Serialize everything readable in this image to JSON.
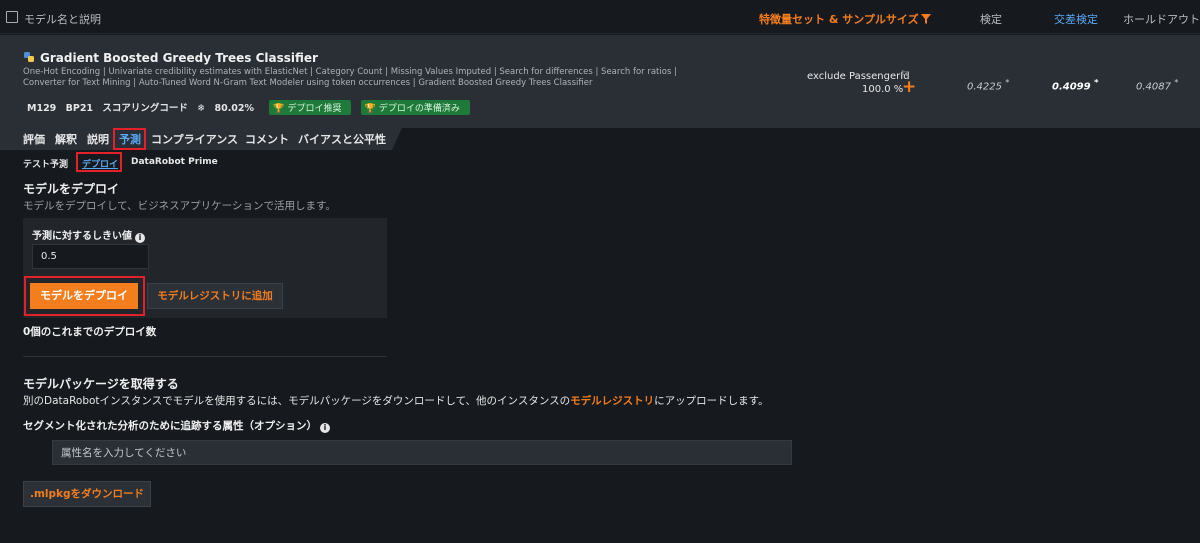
{
  "header": {
    "model_name_label": "モデル名と説明",
    "feature_set_label": "特徴量セット & サンプルサイズ",
    "validation_label": "検定",
    "cross_validation_label": "交差検定",
    "holdout_label": "ホールドアウト"
  },
  "model": {
    "title": "Gradient Boosted Greedy Trees Classifier",
    "description": "One-Hot Encoding | Univariate credibility estimates with ElasticNet | Category Count | Missing Values Imputed | Search for differences | Search for ratios | Converter for Text Mining | Auto-Tuned Word N-Gram Text Modeler using token occurrences | Gradient Boosted Greedy Trees Classifier",
    "model_id": "M129",
    "blueprint_id": "BP21",
    "scoring_code": "スコアリングコード",
    "accuracy": "80.02%",
    "badge_recommended": "デプロイ推奨",
    "badge_ready": "デプロイの準備済み",
    "feature_list": "exclude PassengerId",
    "sample_size": "100.0 %",
    "score_validation": "0.4225",
    "score_cv": "0.4099",
    "score_holdout": "0.4087",
    "score_marker": "*"
  },
  "tabs": [
    "評価",
    "解釈",
    "説明",
    "予測",
    "コンプライアンス",
    "コメント",
    "バイアスと公平性"
  ],
  "subtabs": [
    "テスト予測",
    "デプロイ",
    "DataRobot Prime"
  ],
  "deploy": {
    "title": "モデルをデプロイ",
    "subtitle": "モデルをデプロイして、ビジネスアプリケーションで活用します。",
    "threshold_label": "予測に対するしきい値",
    "threshold_value": "0.5",
    "deploy_button": "モデルをデプロイ",
    "registry_button": "モデルレジストリに追加",
    "deploy_count": "0個のこれまでのデプロイ数"
  },
  "package": {
    "title": "モデルパッケージを取得する",
    "text_before": "別のDataRobotインスタンスでモデルを使用するには、モデルパッケージをダウンロードして、他のインスタンスの",
    "text_link": "モデルレジストリ",
    "text_after": "にアップロードします。",
    "attribute_label": "セグメント化された分析のために追跡する属性（オプション）",
    "attribute_placeholder": "属性名を入力してください",
    "download_button": ".mlpkgをダウンロード"
  },
  "colors": {
    "accent_orange": "#f47d1e",
    "link_blue": "#5aa9f5",
    "highlight_red": "#e3212b",
    "badge_green": "#1f7a3a"
  }
}
